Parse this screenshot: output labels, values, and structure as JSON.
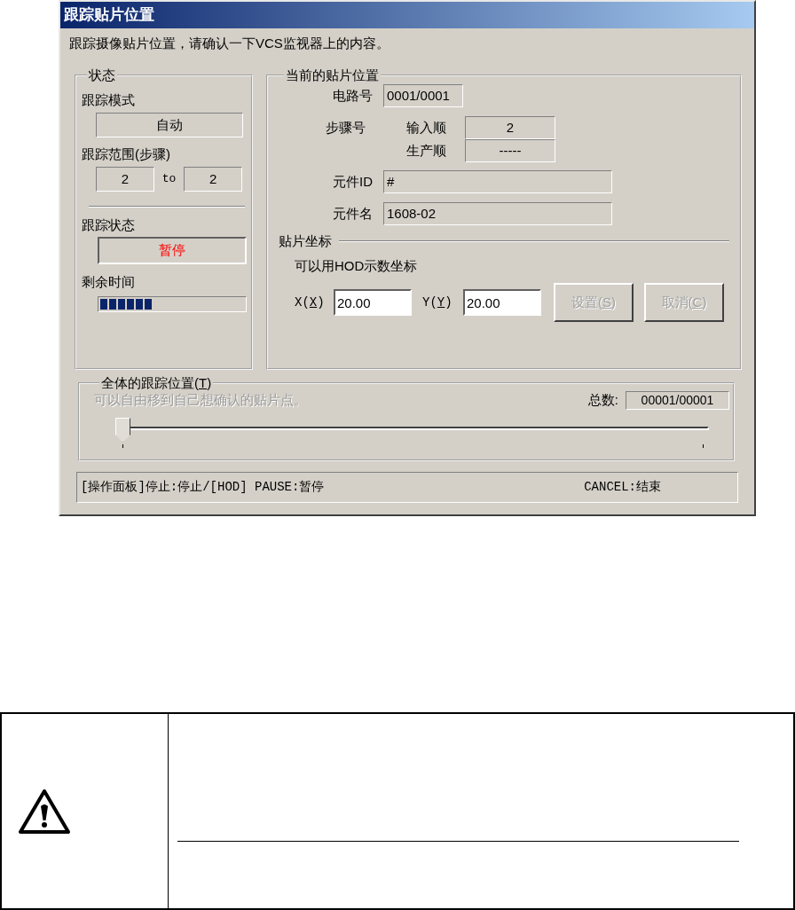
{
  "window": {
    "title": "跟踪贴片位置"
  },
  "instruction": "跟踪摄像贴片位置，请确认一下VCS监视器上的内容。",
  "status_group": {
    "title": "状态",
    "mode_label": "跟踪模式",
    "mode": "自动",
    "range_label": "跟踪范围(步骤)",
    "range_from": "2",
    "range_sep": "to",
    "range_to": "2",
    "state_label": "跟踪状态",
    "state": "暂停",
    "remaining_label": "剩余时间",
    "remaining": {
      "level": 0.37
    }
  },
  "position_group": {
    "title": "当前的贴片位置",
    "circuit_label": "电路号",
    "circuit": "0001/0001",
    "step_label": "步骤号",
    "input_order_label": "输入顺",
    "input_order": "2",
    "production_order_label": "生产顺",
    "production_order": "-----",
    "part_id_label": "元件ID",
    "part_id": "#",
    "part_name_label": "元件名",
    "part_name": "1608-02",
    "coords_title": "贴片坐标",
    "coords_hint": "可以用HOD示数坐标",
    "x_label": [
      "X(",
      "X",
      ")"
    ],
    "x_value": "20.00",
    "y_label": [
      "Y(",
      "Y",
      ")"
    ],
    "y_value": "20.00",
    "buttons": [
      {
        "label": [
          "设置(",
          "S",
          ")"
        ],
        "disabled": true
      },
      {
        "label": [
          "取消(",
          "C",
          ")"
        ],
        "disabled": true
      }
    ]
  },
  "overall_group": {
    "title": [
      "全体的跟踪位置(",
      "T",
      ")"
    ],
    "hint": "可以自由移到自己想确认的贴片点。",
    "total_label": "总数:",
    "total": "00001/00001",
    "slider": {
      "level": 0
    }
  },
  "status_bar": {
    "left": "[操作面板]停止:停止/[HOD] PAUSE:暂停",
    "right": "CANCEL:结束"
  }
}
